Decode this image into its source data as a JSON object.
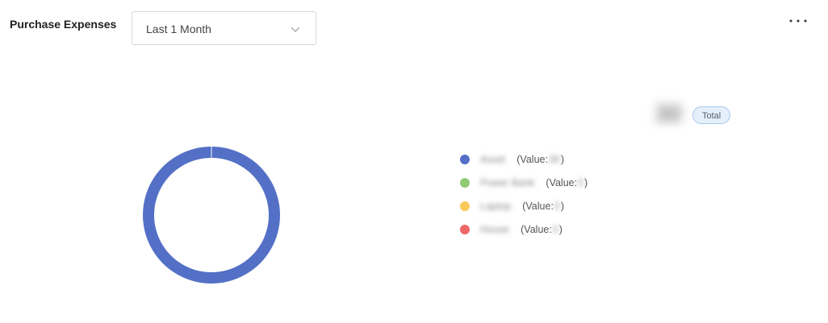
{
  "header": {
    "title": "Purchase Expenses",
    "period_select": {
      "value": "Last 1 Month"
    },
    "more_icon": "more-horizontal-icon"
  },
  "summary": {
    "total_value": "30",
    "total_badge": "Total"
  },
  "chart_data": {
    "type": "pie",
    "donut": true,
    "categories": [
      "Asset",
      "Power Bank",
      "Laptop",
      "House"
    ],
    "values": [
      30,
      0,
      0,
      0
    ],
    "colors": [
      "#5470c6",
      "#91cc75",
      "#fac858",
      "#ee6666"
    ],
    "legend_placement": "right"
  },
  "legend": {
    "value_prefix": "(Value: ",
    "value_suffix": ")",
    "items": [
      {
        "label": "Asset",
        "value": "30",
        "color": "#5470c6"
      },
      {
        "label": "Power Bank",
        "value": "0",
        "color": "#91cc75"
      },
      {
        "label": "Laptop",
        "value": "0",
        "color": "#fac858"
      },
      {
        "label": "House",
        "value": "0",
        "color": "#ee6666"
      }
    ]
  }
}
